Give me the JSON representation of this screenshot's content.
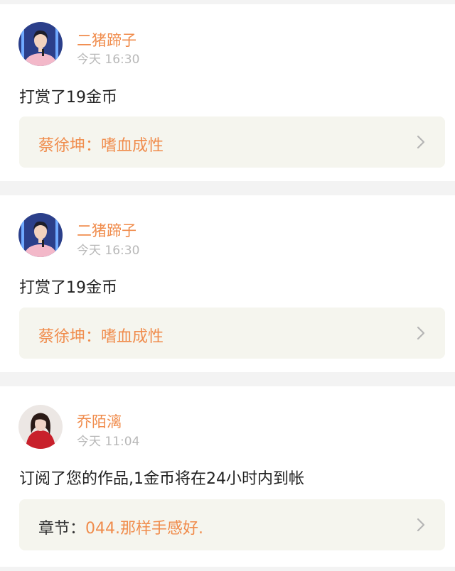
{
  "colors": {
    "accent": "#f08c4c",
    "time": "#b8b8b8",
    "text": "#222222",
    "box": "#f5f5ee",
    "background": "#f3f3f3"
  },
  "items": [
    {
      "username": "二猪蹄子",
      "time": "今天 16:30",
      "message": "打赏了19金币",
      "link_prefix": "",
      "link_title": "蔡徐坤：嗜血成性",
      "avatar_icon": "avatar-boy-pink-jacket",
      "chevron_icon": "chevron-right-icon"
    },
    {
      "username": "二猪蹄子",
      "time": "今天 16:30",
      "message": "打赏了19金币",
      "link_prefix": "",
      "link_title": "蔡徐坤：嗜血成性",
      "avatar_icon": "avatar-boy-pink-jacket",
      "chevron_icon": "chevron-right-icon"
    },
    {
      "username": "乔陌漓",
      "time": "今天 11:04",
      "message": "订阅了您的作品,1金币将在24小时内到帐",
      "link_prefix": "章节：",
      "link_title": "044.那样手感好.",
      "avatar_icon": "avatar-girl-red-top",
      "chevron_icon": "chevron-right-icon"
    }
  ]
}
